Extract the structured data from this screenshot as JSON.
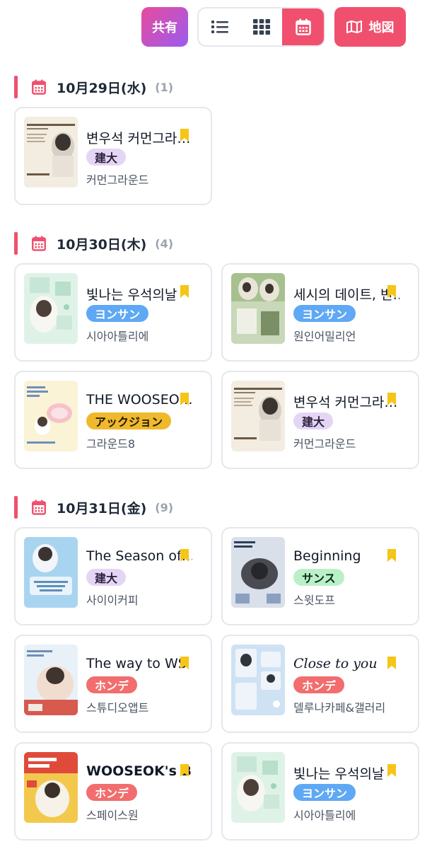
{
  "toolbar": {
    "share_label": "共有",
    "map_label": "地図",
    "views": [
      {
        "name": "list-view",
        "icon": "list-icon"
      },
      {
        "name": "grid-view",
        "icon": "grid-icon"
      },
      {
        "name": "calendar-view",
        "icon": "calendar-icon",
        "active": true
      }
    ]
  },
  "sections": [
    {
      "date": "10月29日(水)",
      "count": "(1)",
      "events": [
        {
          "title": "변우석 커먼그라…",
          "tag": "建大",
          "tag_color": "purple",
          "venue": "커먼그라운드"
        }
      ]
    },
    {
      "date": "10月30日(木)",
      "count": "(4)",
      "events": [
        {
          "title": "빛나는 우석의날",
          "tag": "ヨンサン",
          "tag_color": "blue",
          "venue": "시아아틀리에"
        },
        {
          "title": "세시의 데이트, 변…",
          "tag": "ヨンサン",
          "tag_color": "blue",
          "venue": "원인어밀리언"
        },
        {
          "title": "THE WOOSEO…",
          "tag": "アックジョン",
          "tag_color": "yellow",
          "venue": "그라운드8"
        },
        {
          "title": "변우석 커먼그라…",
          "tag": "建大",
          "tag_color": "purple",
          "venue": "커먼그라운드"
        }
      ]
    },
    {
      "date": "10月31日(金)",
      "count": "(9)",
      "events": [
        {
          "title": "The Season of…",
          "tag": "建大",
          "tag_color": "purple",
          "venue": "사이이커피"
        },
        {
          "title": "Beginning",
          "tag": "サンス",
          "tag_color": "green",
          "venue": "스윗도프"
        },
        {
          "title": "The way to WS",
          "tag": "ホンデ",
          "tag_color": "red",
          "venue": "스튜디오앱트"
        },
        {
          "title": "Close to you",
          "tag": "ホンデ",
          "tag_color": "red",
          "venue": "델루나카페&갤러리"
        },
        {
          "title": "WOOSEOK's BU…",
          "tag": "ホンデ",
          "tag_color": "red",
          "venue": "스페이스원"
        },
        {
          "title": "빛나는 우석의날",
          "tag": "ヨンサン",
          "tag_color": "blue",
          "venue": "시아아틀리에"
        }
      ]
    }
  ],
  "colors": {
    "accent": "#f0506e",
    "bookmark": "#f5c518"
  }
}
